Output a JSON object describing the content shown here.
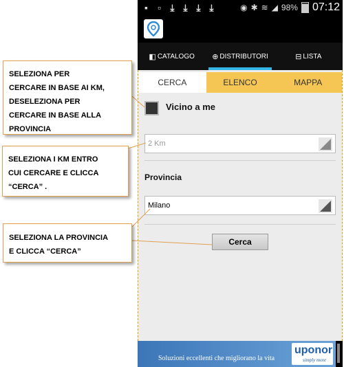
{
  "status_bar": {
    "battery": "98%",
    "time": "07:12"
  },
  "main_tabs": [
    {
      "label": "CATALOGO",
      "icon": "catalog-icon"
    },
    {
      "label": "DISTRIBUTORI",
      "icon": "globe-icon"
    },
    {
      "label": "LISTA",
      "icon": "basket-icon"
    }
  ],
  "sub_tabs": [
    {
      "label": "CERCA"
    },
    {
      "label": "ELENCO"
    },
    {
      "label": "MAPPA"
    }
  ],
  "form": {
    "near_me_label": "Vicino a me",
    "km_value": "2 Km",
    "province_label": "Provincia",
    "province_value": "Milano",
    "search_button": "Cerca"
  },
  "banner": {
    "slogan": "Soluzioni eccellenti che migliorano la vita",
    "brand": "uponor",
    "tagline": "simply more"
  },
  "callouts": [
    {
      "lines": [
        "SELEZIONA PER",
        "CERCARE IN BASE AI KM,",
        "DESELEZIONA PER",
        "CERCARE IN BASE ALLA",
        "PROVINCIA"
      ]
    },
    {
      "lines": [
        "SELEZIONA I KM ENTRO",
        "CUI CERCARE E CLICCA",
        "“CERCA” ."
      ]
    },
    {
      "lines": [
        "SELEZIONA LA PROVINCIA",
        "E CLICCA “CERCA”"
      ]
    }
  ],
  "colors": {
    "accent": "#33b5e5",
    "tab_inactive": "#f5c653",
    "callout_border": "#e0a050"
  }
}
